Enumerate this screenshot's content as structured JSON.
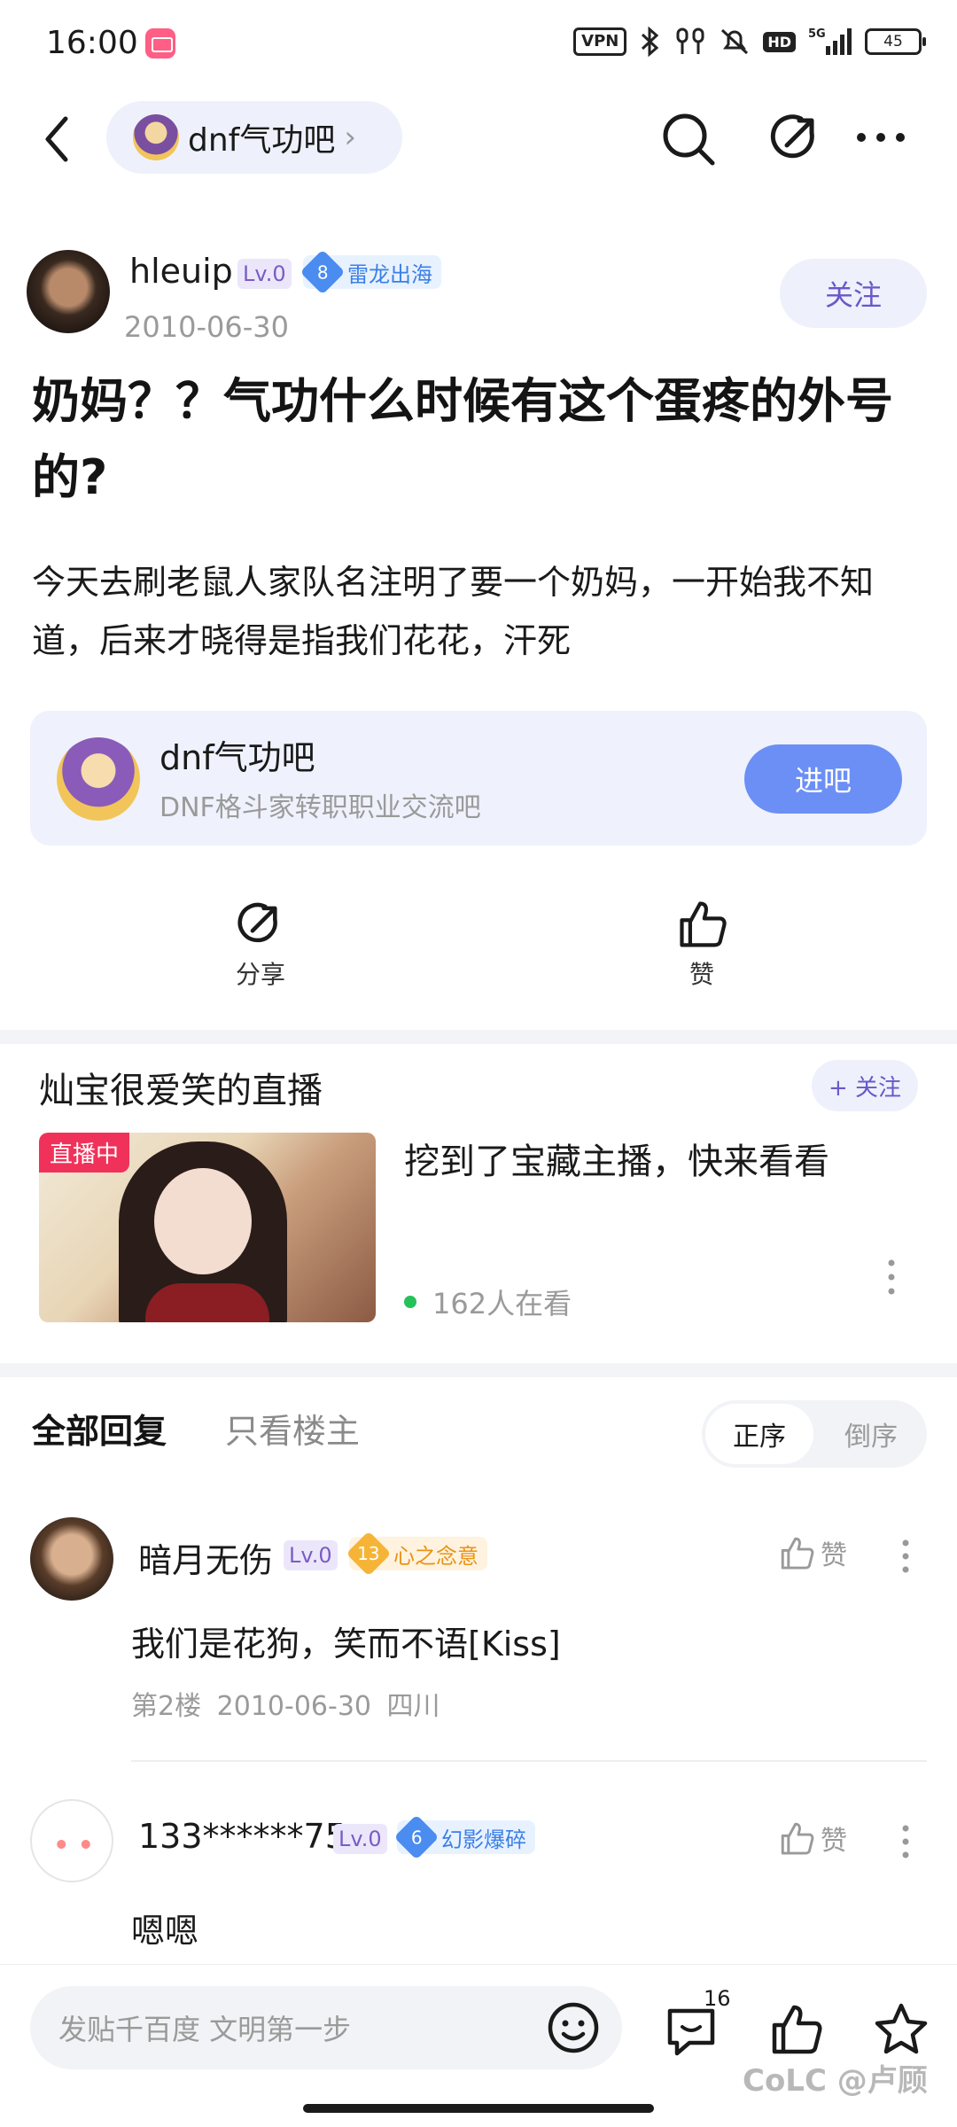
{
  "status_bar": {
    "time": "16:00",
    "vpn": "VPN",
    "hd": "HD",
    "network": "5G",
    "battery": "45"
  },
  "nav": {
    "forum_label": "dnf气功吧"
  },
  "author": {
    "name": "hleuip",
    "level": "Lv.0",
    "title_num": "8",
    "title_name": "雷龙出海",
    "date": "2010-06-30",
    "follow_label": "关注"
  },
  "post": {
    "title": "奶妈？？气功什么时候有这个蛋疼的外号的?",
    "body": "今天去刷老鼠人家队名注明了要一个奶妈，一开始我不知道，后来才晓得是指我们花花，汗死"
  },
  "forum_card": {
    "name": "dnf气功吧",
    "description": "DNF格斗家转职职业交流吧",
    "enter_label": "进吧"
  },
  "actions": {
    "share_label": "分享",
    "like_label": "赞"
  },
  "live": {
    "streamer_title": "灿宝很爱笑的直播",
    "follow_label": "+ 关注",
    "badge": "直播中",
    "caption": "挖到了宝藏主播，快来看看",
    "viewers": "162人在看"
  },
  "replies_header": {
    "tab_all": "全部回复",
    "tab_op_only": "只看楼主",
    "sort_asc": "正序",
    "sort_desc": "倒序"
  },
  "replies": [
    {
      "name": "暗月无伤",
      "level": "Lv.0",
      "title_num": "13",
      "title_name": "心之念意",
      "like_label": "赞",
      "text": "我们是花狗，笑而不语[Kiss]",
      "floor": "第2楼",
      "date": "2010-06-30",
      "location": "四川"
    },
    {
      "name": "133******75",
      "level": "Lv.0",
      "title_num": "6",
      "title_name": "幻影爆碎",
      "like_label": "赞",
      "text": "嗯嗯"
    }
  ],
  "bottom_bar": {
    "input_placeholder": "发贴千百度 文明第一步",
    "comment_count": "16"
  },
  "watermark": "CoLC @卢顾",
  "colors": {
    "accent_purple": "#6a58c8",
    "enter_button": "#6b8ff5",
    "live_badge": "#f0325a",
    "live_dot": "#26c15a"
  }
}
